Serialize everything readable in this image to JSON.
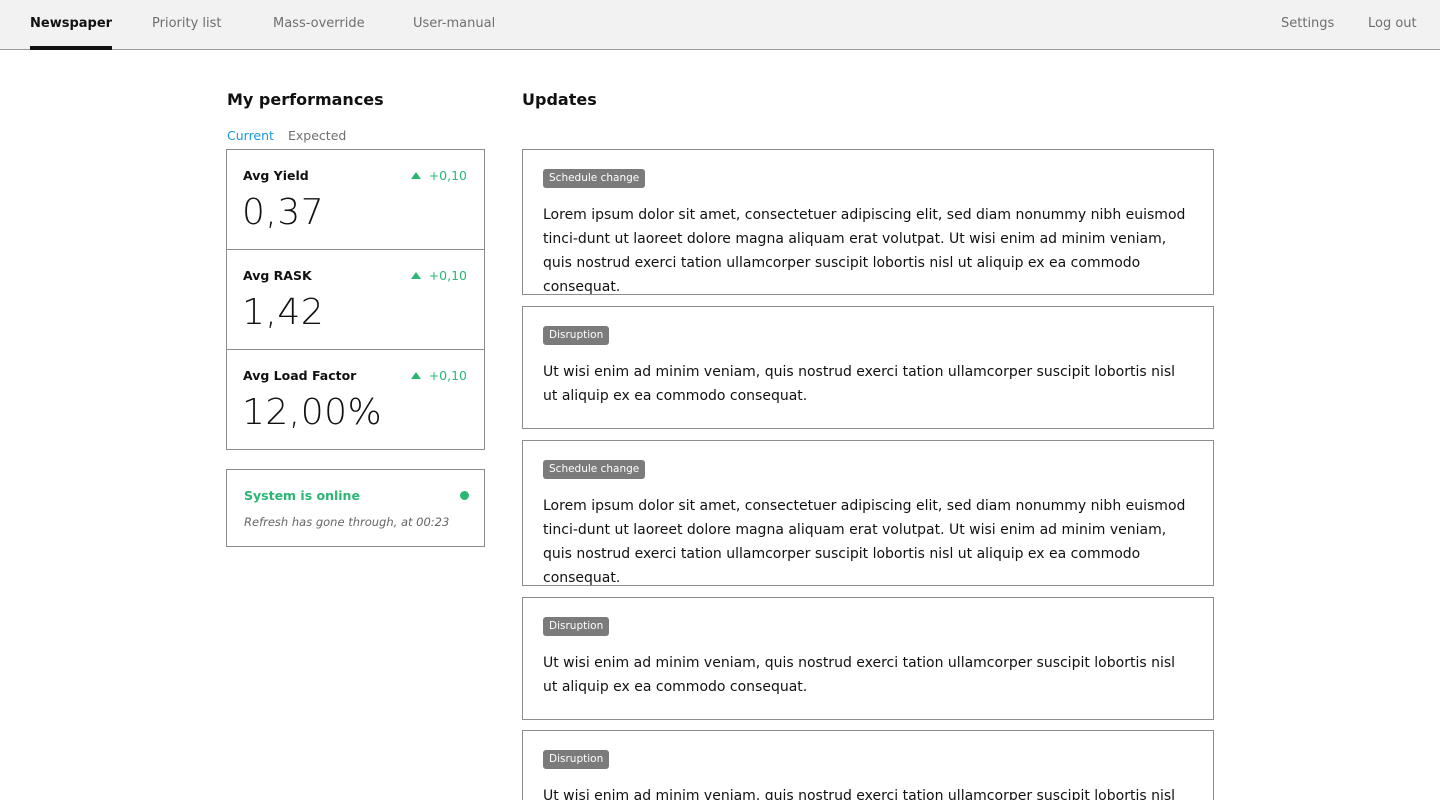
{
  "nav": {
    "left": [
      "Newspaper",
      "Priority list",
      "Mass-override",
      "User-manual"
    ],
    "right": [
      "Settings",
      "Log out"
    ],
    "active": "Newspaper"
  },
  "performance": {
    "title": "My performances",
    "tabs": [
      "Current",
      "Expected"
    ],
    "active_tab": "Current",
    "metrics": [
      {
        "label": "Avg Yield",
        "value": "0,37",
        "delta": "+0,10"
      },
      {
        "label": "Avg RASK",
        "value": "1,42",
        "delta": "+0,10"
      },
      {
        "label": "Avg Load Factor",
        "value": "12,00%",
        "delta": "+0,10"
      }
    ]
  },
  "status": {
    "title": "System is online",
    "subtitle": "Refresh has gone through, at 00:23"
  },
  "updates": {
    "title": "Updates",
    "items": [
      {
        "tag": "Schedule change",
        "text": "Lorem ipsum dolor sit amet, consectetuer adipiscing elit, sed diam nonummy nibh euismod tinci-dunt ut laoreet dolore magna aliquam erat volutpat. Ut wisi enim ad minim veniam, quis nostrud exerci tation ullamcorper suscipit lobortis nisl ut aliquip ex ea commodo consequat."
      },
      {
        "tag": "Disruption",
        "text": "Ut wisi enim ad minim veniam, quis nostrud exerci tation ullamcorper suscipit lobortis nisl ut aliquip ex ea commodo consequat."
      },
      {
        "tag": "Schedule change",
        "text": "Lorem ipsum dolor sit amet, consectetuer adipiscing elit, sed diam nonummy nibh euismod tinci-dunt ut laoreet dolore magna aliquam erat volutpat. Ut wisi enim ad minim veniam, quis nostrud exerci tation ullamcorper suscipit lobortis nisl ut aliquip ex ea commodo consequat."
      },
      {
        "tag": "Disruption",
        "text": "Ut wisi enim ad minim veniam, quis nostrud exerci tation ullamcorper suscipit lobortis nisl ut aliquip ex ea commodo consequat."
      },
      {
        "tag": "Disruption",
        "text": "Ut wisi enim ad minim veniam, quis nostrud exerci tation ullamcorper suscipit lobortis nisl ut aliquip ex ea commodo consequat."
      }
    ]
  },
  "colors": {
    "accent": "#1a9ad6",
    "positive": "#2bb673",
    "badge": "#7b7b7b"
  },
  "icons": {
    "delta": "triangle-up-icon",
    "status": "status-dot-icon"
  }
}
